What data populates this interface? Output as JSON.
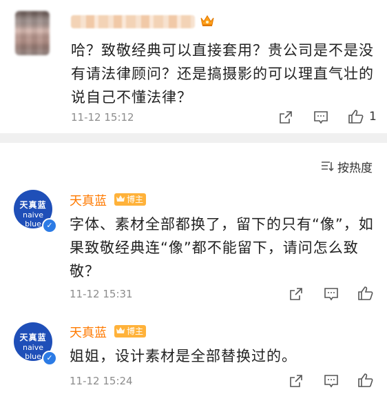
{
  "comments": [
    {
      "text_lines": [
        "哈？致敬经典可以直接套用？贵公司是不是没",
        "有请法律顾问？还是搞摄影的可以理直气壮的",
        "说自己不懂法律？"
      ],
      "timestamp": "11-12 15:12",
      "likes": "1"
    }
  ],
  "sort": {
    "label": "按热度"
  },
  "replies": [
    {
      "author": "天真蓝",
      "badge": "博主",
      "avatar_line1": "天真蓝",
      "avatar_line2": "naive blue",
      "text_lines": [
        "字体、素材全部都换了，留下的只有“像”，如",
        "果致敬经典连“像”都不能留下，请问怎么致",
        "敬？"
      ],
      "timestamp": "11-12 15:31"
    },
    {
      "author": "天真蓝",
      "badge": "博主",
      "avatar_line1": "天真蓝",
      "avatar_line2": "naive blue",
      "text_lines": [
        "姐姐，设计素材是全部替换过的。"
      ],
      "timestamp": "11-12 15:24"
    }
  ],
  "colors": {
    "accent": "#ff7a00",
    "badge": "#ffb23a",
    "brand_avatar": "#1f4fb8",
    "verified": "#2c7be5"
  }
}
